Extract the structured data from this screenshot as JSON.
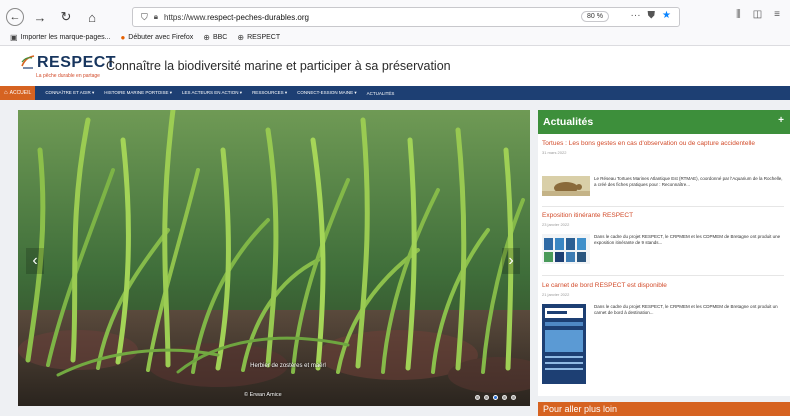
{
  "browser": {
    "url_prefix": "https://www.",
    "url_domain": "respect-peches-durables.org",
    "zoom": "80 %",
    "bookmarks": [
      {
        "label": "Importer les marque-pages..."
      },
      {
        "label": "Débuter avec Firefox"
      },
      {
        "label": "BBC"
      },
      {
        "label": "RESPECT"
      }
    ]
  },
  "site": {
    "logo_text": "RESPECT",
    "logo_tagline": "La pêche durable en partage",
    "title": "Connaître la biodiversité marine et participer à sa préservation",
    "nav": {
      "home": "ACCUEIL",
      "items": [
        "CONNAÎTRE ET AGIR ▾",
        "HISTOIRE MARINE PORTOISE ▾",
        "LES ACTEURS EN ACTION ▾",
        "RESSOURCES ▾",
        "CONNECT-ESSION MAINE ▾",
        "ACTUALITÉS"
      ]
    }
  },
  "slider": {
    "caption": "Herbier de zostères et maërl",
    "credit": "© Erwan Amice",
    "slide_count": 5,
    "active_slide": 2
  },
  "news": {
    "heading": "Actualités",
    "articles": [
      {
        "title": "Tortues : Les bons gestes en cas d'observation ou de capture accidentelle",
        "date": "31 mars 2022",
        "text": "Le Réseau Tortues Marines Atlantique Est (RTMAE), coordonné par l'Aquarium de la Rochelle, a créé des fiches pratiques pour : Reconnaître..."
      },
      {
        "title": "Exposition itinérante RESPECT",
        "date": "23 janvier 2022",
        "text": "Dans le cadre du projet RESPECT, le CRPMEM et les CDPMEM de Bretagne ont produit une exposition itinérante de 9 stands..."
      },
      {
        "title": "Le carnet de bord RESPECT est disponible",
        "date": "21 janvier 2022",
        "text": "Dans le cadre du projet RESPECT, le CRPMEM et les CDPMEM de Bretagne ont produit un carnet de bord à destination..."
      }
    ]
  },
  "aller_plus_loin": "Pour aller plus loin",
  "colors": {
    "navbar": "#1d3f73",
    "accent_orange": "#d66321",
    "news_green": "#3d8f3b",
    "article_title": "#d24b2a"
  }
}
